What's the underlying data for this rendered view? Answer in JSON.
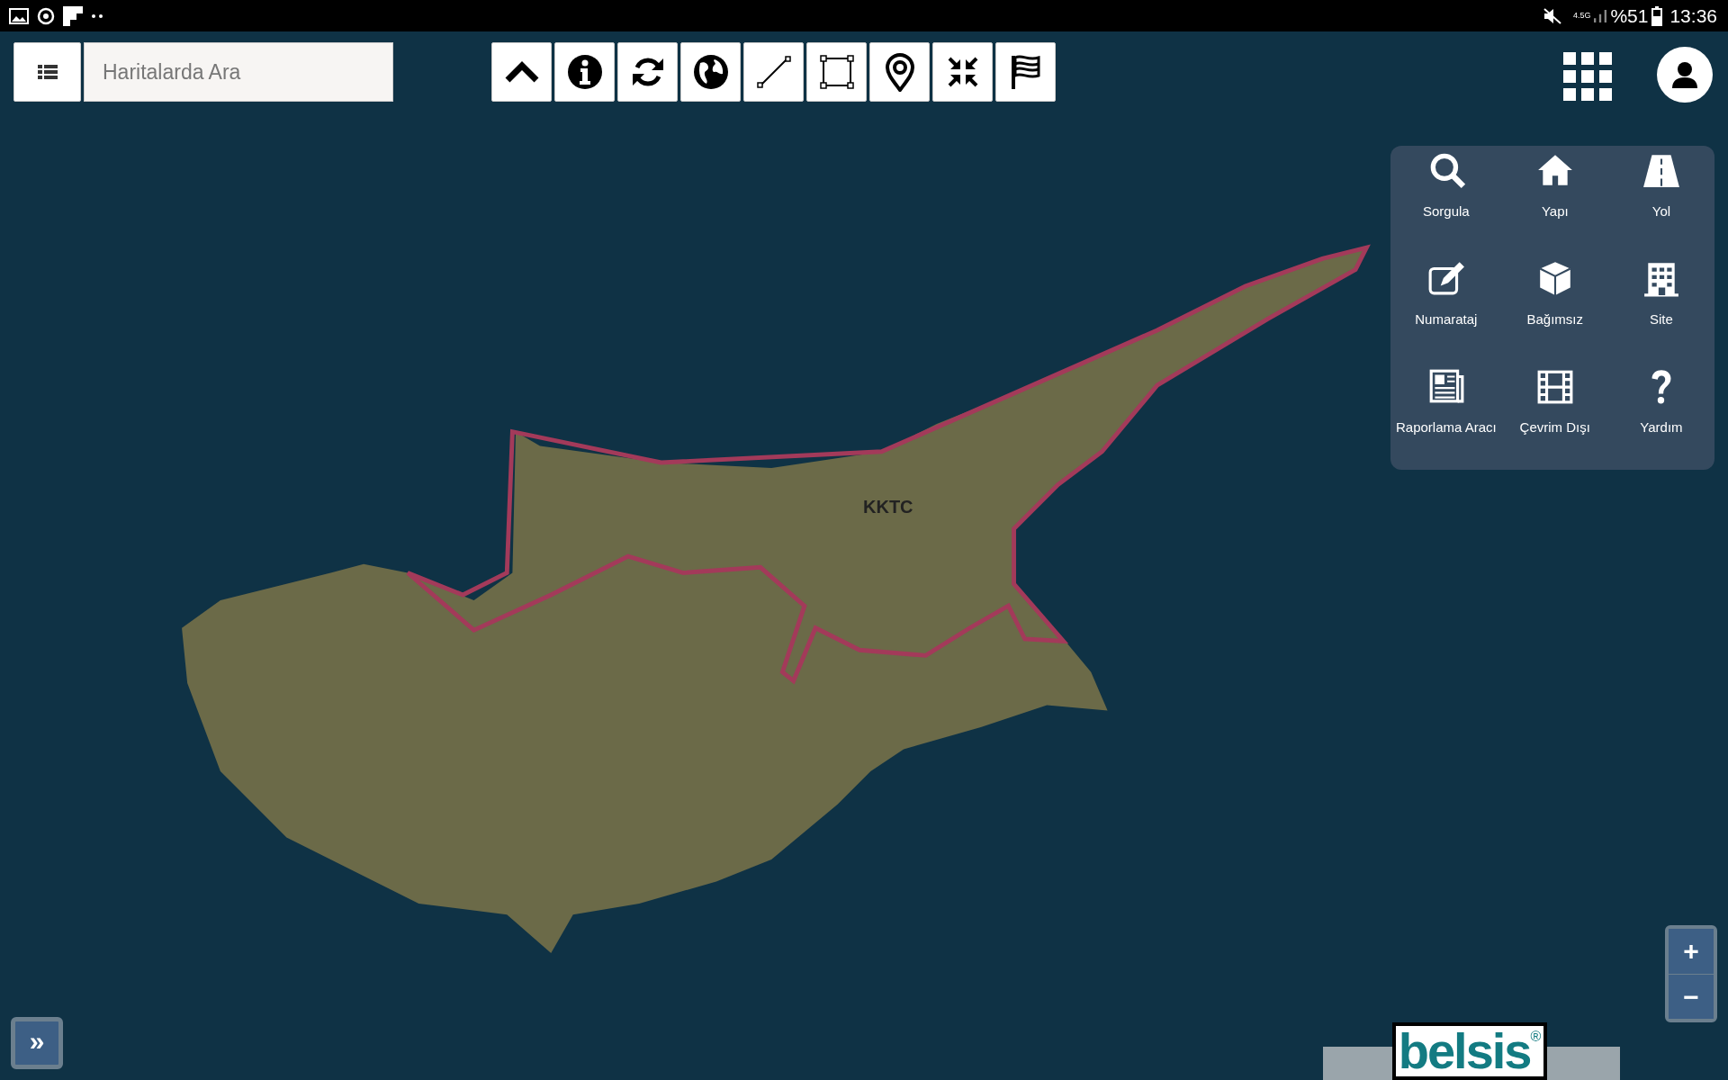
{
  "status_bar": {
    "network": "4.5G",
    "battery": "%51",
    "time": "13:36"
  },
  "search": {
    "placeholder": "Haritalarda Ara"
  },
  "menu": [
    {
      "label": "Sorgula"
    },
    {
      "label": "Yapı"
    },
    {
      "label": "Yol"
    },
    {
      "label": "Numarataj"
    },
    {
      "label": "Bağımsız"
    },
    {
      "label": "Site"
    },
    {
      "label": "Raporlama Aracı"
    },
    {
      "label": "Çevrim Dışı"
    },
    {
      "label": "Yardım"
    }
  ],
  "map": {
    "label": "KKTC"
  },
  "zoom": {
    "in": "+",
    "out": "−"
  },
  "panel_toggle": "»",
  "logo": {
    "text": "belsis",
    "mark": "®"
  }
}
